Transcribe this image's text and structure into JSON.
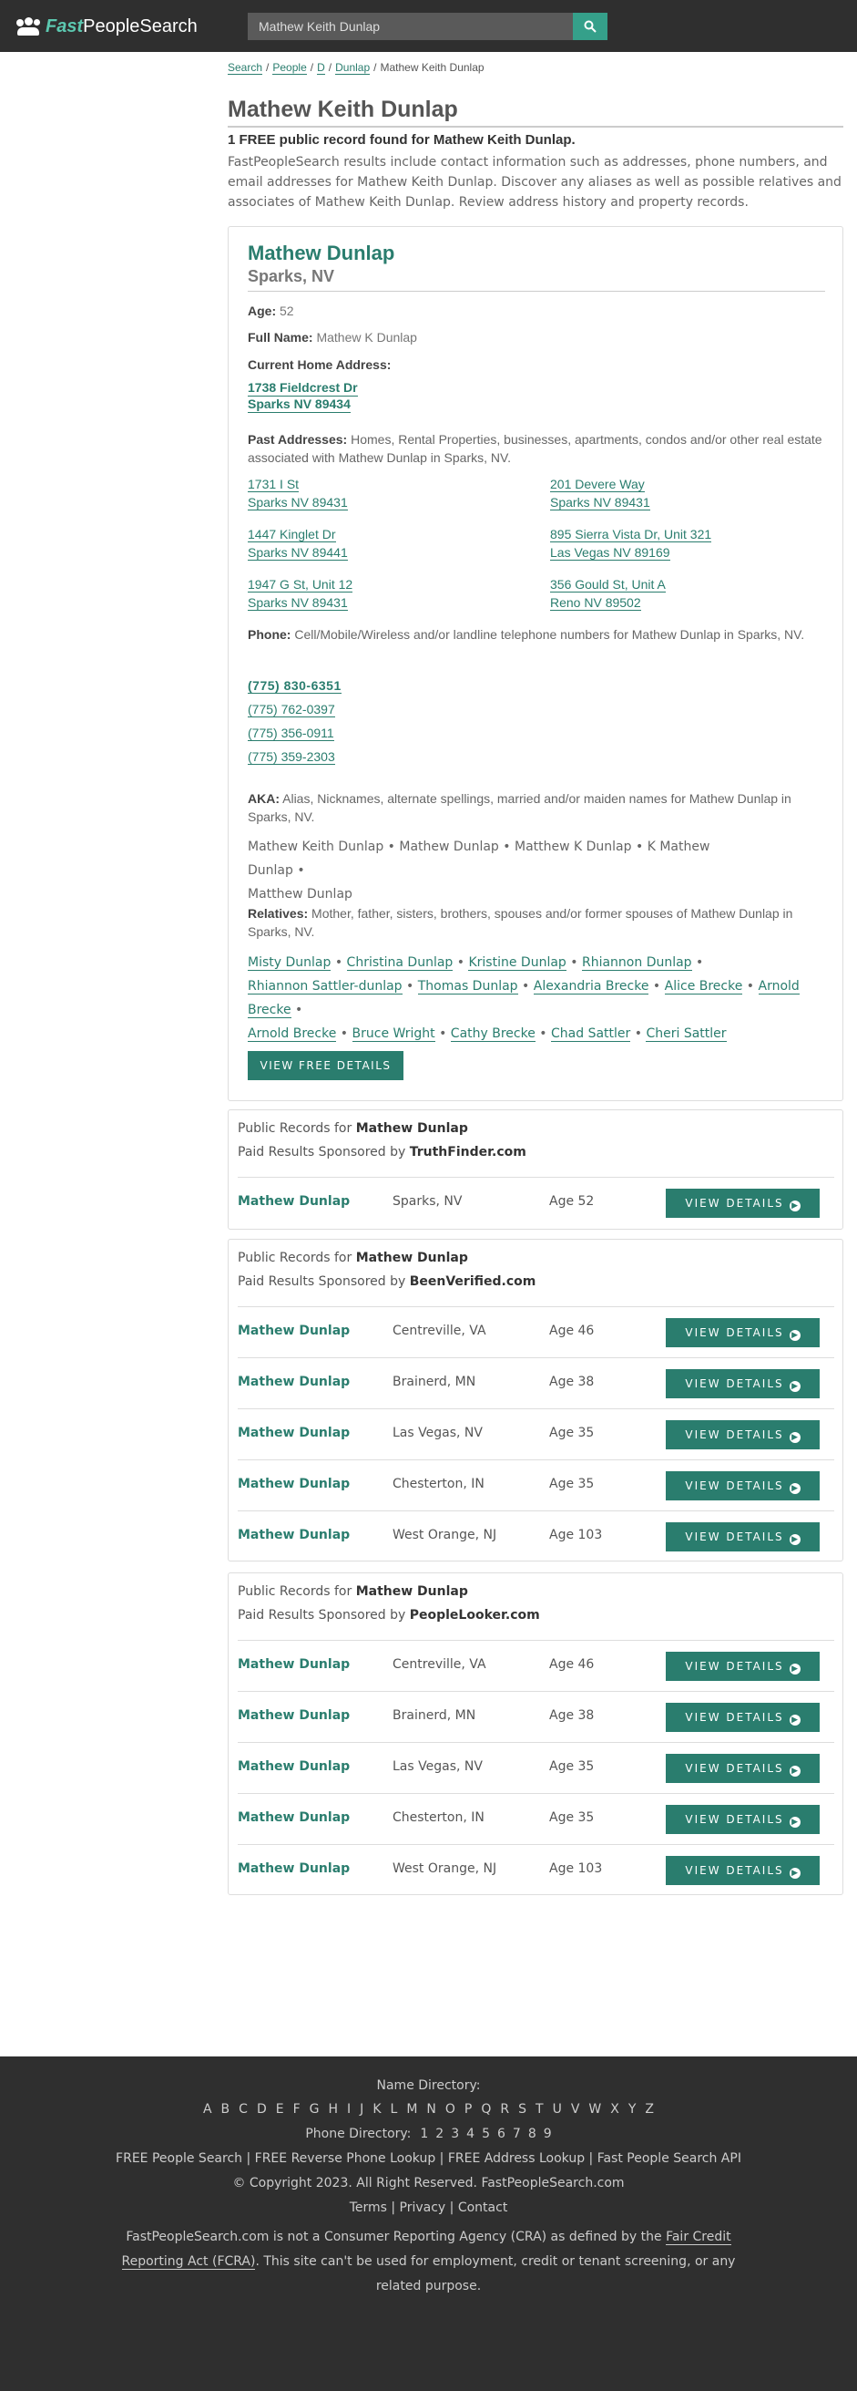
{
  "header": {
    "logo_fast": "Fast",
    "logo_rest": "PeopleSearch",
    "search_value": "Mathew Keith Dunlap"
  },
  "breadcrumb": [
    "Search",
    "People",
    "D",
    "Dunlap",
    "Mathew Keith Dunlap"
  ],
  "page_title": "Mathew Keith Dunlap",
  "found_text": "1 FREE public record found for Mathew Keith Dunlap.",
  "intro_text": "FastPeopleSearch results include contact information such as addresses, phone numbers, and email addresses for Mathew Keith Dunlap. Discover any aliases as well as possible relatives and associates of Mathew Keith Dunlap. Review address history and property records.",
  "card": {
    "name": "Mathew Dunlap",
    "location": "Sparks, NV",
    "age_label": "Age:",
    "age": "52",
    "fullname_label": "Full Name:",
    "fullname": "Mathew K Dunlap",
    "current_label": "Current Home Address:",
    "current_line1": "1738 Fieldcrest Dr",
    "current_line2": "Sparks NV 89434",
    "past_label": "Past Addresses:",
    "past_text": "Homes, Rental Properties, businesses, apartments, condos and/or other real estate associated with Mathew Dunlap in Sparks, NV.",
    "past_addresses": [
      {
        "line1": "1731 I St",
        "line2": "Sparks NV 89431"
      },
      {
        "line1": "201 Devere Way",
        "line2": "Sparks NV 89431"
      },
      {
        "line1": "1447 Kinglet Dr",
        "line2": "Sparks NV 89441"
      },
      {
        "line1": "895 Sierra Vista Dr, Unit 321",
        "line2": "Las Vegas NV 89169"
      },
      {
        "line1": "1947 G St, Unit 12",
        "line2": "Sparks NV 89431"
      },
      {
        "line1": "356 Gould St, Unit A",
        "line2": "Reno NV 89502"
      }
    ],
    "phone_label": "Phone:",
    "phone_text": "Cell/Mobile/Wireless and/or landline telephone numbers for Mathew Dunlap in Sparks, NV.",
    "phones": [
      "(775) 830-6351",
      "(775) 762-0397",
      "(775) 356-0911",
      "(775) 359-2303"
    ],
    "aka_label": "AKA:",
    "aka_text": "Alias, Nicknames, alternate spellings, married and/or maiden names for Mathew Dunlap in Sparks, NV.",
    "aka_names": [
      "Mathew Keith Dunlap",
      "Mathew Dunlap",
      "Matthew K Dunlap",
      "K Mathew Dunlap",
      "Matthew Dunlap"
    ],
    "relatives_label": "Relatives:",
    "relatives_text": "Mother, father, sisters, brothers, spouses and/or former spouses of Mathew Dunlap in Sparks, NV.",
    "relatives": [
      "Misty Dunlap",
      "Christina Dunlap",
      "Kristine Dunlap",
      "Rhiannon Dunlap",
      "Rhiannon Sattler-dunlap",
      "Thomas Dunlap",
      "Alexandria Brecke",
      "Alice Brecke",
      "Arnold Brecke",
      "Arnold Brecke",
      "Bruce Wright",
      "Cathy Brecke",
      "Chad Sattler",
      "Cheri Sattler"
    ],
    "button": "VIEW FREE DETAILS"
  },
  "panels": [
    {
      "title_prefix": "Public Records for",
      "title_name": "Mathew Dunlap",
      "sub_prefix": "Paid Results Sponsored by",
      "sponsor": "TruthFinder.com",
      "rows": [
        {
          "name": "Mathew Dunlap",
          "city": "Sparks, NV",
          "age": "Age 52",
          "button": "VIEW DETAILS"
        }
      ]
    },
    {
      "title_prefix": "Public Records for",
      "title_name": "Mathew Dunlap",
      "sub_prefix": "Paid Results Sponsored by",
      "sponsor": "BeenVerified.com",
      "rows": [
        {
          "name": "Mathew Dunlap",
          "city": "Centreville, VA",
          "age": "Age 46",
          "button": "VIEW DETAILS"
        },
        {
          "name": "Mathew Dunlap",
          "city": "Brainerd, MN",
          "age": "Age 38",
          "button": "VIEW DETAILS"
        },
        {
          "name": "Mathew Dunlap",
          "city": "Las Vegas, NV",
          "age": "Age 35",
          "button": "VIEW DETAILS"
        },
        {
          "name": "Mathew Dunlap",
          "city": "Chesterton, IN",
          "age": "Age 35",
          "button": "VIEW DETAILS"
        },
        {
          "name": "Mathew Dunlap",
          "city": "West Orange, NJ",
          "age": "Age 103",
          "button": "VIEW DETAILS"
        }
      ]
    },
    {
      "title_prefix": "Public Records for",
      "title_name": "Mathew Dunlap",
      "sub_prefix": "Paid Results Sponsored by",
      "sponsor": "PeopleLooker.com",
      "rows": [
        {
          "name": "Mathew Dunlap",
          "city": "Centreville, VA",
          "age": "Age 46",
          "button": "VIEW DETAILS"
        },
        {
          "name": "Mathew Dunlap",
          "city": "Brainerd, MN",
          "age": "Age 38",
          "button": "VIEW DETAILS"
        },
        {
          "name": "Mathew Dunlap",
          "city": "Las Vegas, NV",
          "age": "Age 35",
          "button": "VIEW DETAILS"
        },
        {
          "name": "Mathew Dunlap",
          "city": "Chesterton, IN",
          "age": "Age 35",
          "button": "VIEW DETAILS"
        },
        {
          "name": "Mathew Dunlap",
          "city": "West Orange, NJ",
          "age": "Age 103",
          "button": "VIEW DETAILS"
        }
      ]
    }
  ],
  "footer": {
    "name_directory": "Name Directory:",
    "letters": [
      "A",
      "B",
      "C",
      "D",
      "E",
      "F",
      "G",
      "H",
      "I",
      "J",
      "K",
      "L",
      "M",
      "N",
      "O",
      "P",
      "Q",
      "R",
      "S",
      "T",
      "U",
      "V",
      "W",
      "X",
      "Y",
      "Z"
    ],
    "phone_directory": "Phone Directory:",
    "digits": [
      "1",
      "2",
      "3",
      "4",
      "5",
      "6",
      "7",
      "8",
      "9"
    ],
    "links_line": "FREE People Search | FREE Reverse Phone Lookup | FREE Address Lookup | Fast People Search API",
    "copyright": "© Copyright 2023. All Right Reserved. FastPeopleSearch.com",
    "terms_line": "Terms | Privacy | Contact",
    "disclaimer_pre": "FastPeopleSearch.com is not a Consumer Reporting Agency (CRA) as defined by the",
    "disclaimer_link": "Fair Credit Reporting Act (FCRA)",
    "disclaimer_post": ". This site can't be used for employment, credit or tenant screening, or any related purpose."
  }
}
